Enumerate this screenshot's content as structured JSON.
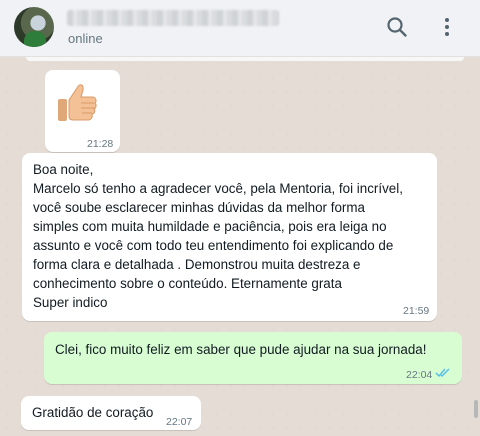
{
  "header": {
    "status": "online",
    "search_icon": "search-icon",
    "menu_icon": "more-vertical-icon"
  },
  "messages": [
    {
      "type": "sticker",
      "emoji": "👍",
      "time": "21:28"
    },
    {
      "type": "text",
      "lines": [
        "Boa noite,",
        "Marcelo só tenho a agradecer você, pela Mentoria, foi incrível,",
        "você soube  esclarecer minhas dúvidas da melhor forma",
        "simples com muita humildade e paciência, pois era  leiga no",
        "assunto e você com todo teu entendimento  foi explicando de",
        "forma clara e detalhada  . Demonstrou muita destreza e",
        "conhecimento sobre o conteúdo. Eternamente grata",
        "Super indico"
      ],
      "time": "21:59"
    },
    {
      "type": "outgoing",
      "text": "Clei, fico muito feliz em saber que pude ajudar na sua jornada!",
      "time": "22:04",
      "status_icon": "double-check-icon"
    },
    {
      "type": "text",
      "text": "Gratidão de coração",
      "time": "22:07"
    }
  ],
  "colors": {
    "chat_background": "#e5ddd5",
    "outgoing_bubble": "#d9fdd3",
    "incoming_bubble": "#ffffff",
    "read_ticks": "#53bdeb"
  }
}
